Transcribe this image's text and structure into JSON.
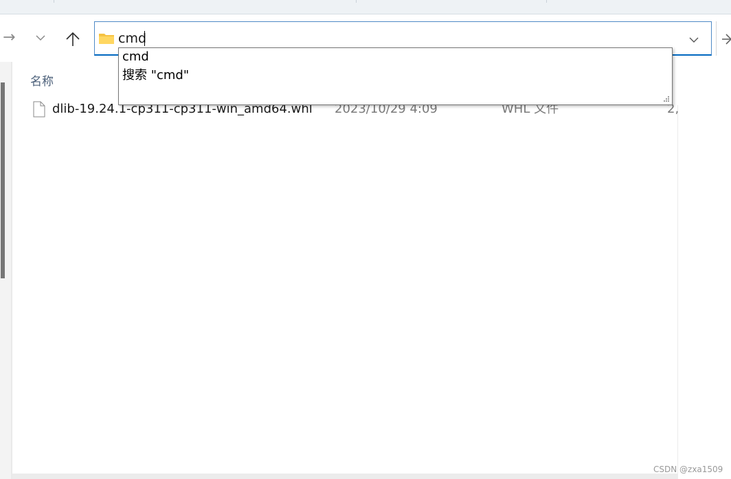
{
  "nav": {
    "forward_glyph": "→",
    "recent_glyph": "⌄",
    "up_glyph": "↑",
    "go_glyph": "→"
  },
  "address_bar": {
    "value": "cmd",
    "dropdown_glyph": "⌄"
  },
  "autocomplete": {
    "items": [
      "cmd",
      "搜索 \"cmd\""
    ]
  },
  "file_list": {
    "columns": [
      "名称"
    ],
    "rows": [
      {
        "name": "dlib-19.24.1-cp311-cp311-win_amd64.whl",
        "modified": "2023/10/29 4:09",
        "type": "WHL 文件",
        "size": "2,"
      }
    ]
  },
  "watermark": "CSDN @zxa1509"
}
